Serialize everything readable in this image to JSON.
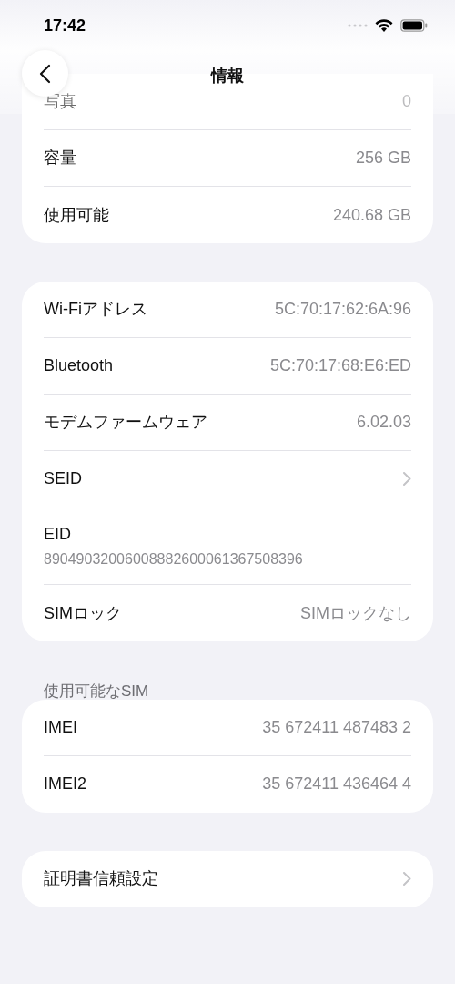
{
  "status_bar": {
    "time": "17:42"
  },
  "nav": {
    "title": "情報"
  },
  "groups": [
    {
      "rows": [
        {
          "kind": "value",
          "label": "写真",
          "value": "0"
        },
        {
          "kind": "value",
          "label": "容量",
          "value": "256 GB"
        },
        {
          "kind": "value",
          "label": "使用可能",
          "value": "240.68 GB"
        }
      ]
    },
    {
      "rows": [
        {
          "kind": "value",
          "label": "Wi-Fiアドレス",
          "value": "5C:70:17:62:6A:96"
        },
        {
          "kind": "value",
          "label": "Bluetooth",
          "value": "5C:70:17:68:E6:ED"
        },
        {
          "kind": "value",
          "label": "モデムファームウェア",
          "value": "6.02.03"
        },
        {
          "kind": "link",
          "label": "SEID"
        },
        {
          "kind": "stacked",
          "label": "EID",
          "value": "89049032006008882600061367508396"
        },
        {
          "kind": "value",
          "label": "SIMロック",
          "value": "SIMロックなし"
        }
      ]
    },
    {
      "header": "使用可能なSIM",
      "rows": [
        {
          "kind": "value",
          "label": "IMEI",
          "value": "35 672411 487483 2"
        },
        {
          "kind": "value",
          "label": "IMEI2",
          "value": "35 672411 436464 4"
        }
      ]
    },
    {
      "rows": [
        {
          "kind": "link",
          "label": "証明書信頼設定"
        }
      ]
    }
  ]
}
